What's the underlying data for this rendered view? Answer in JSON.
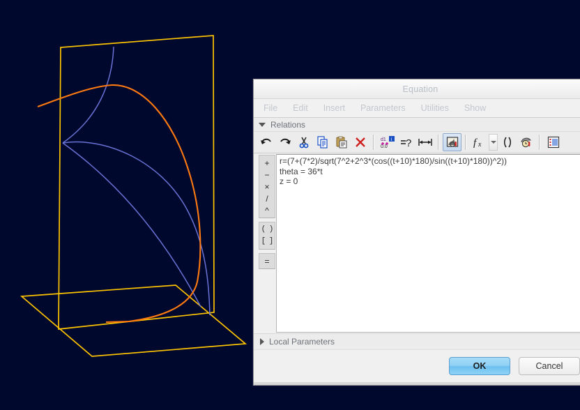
{
  "window": {
    "title": "Equation",
    "menu": [
      "File",
      "Edit",
      "Insert",
      "Parameters",
      "Utilities",
      "Show"
    ]
  },
  "relations": {
    "label": "Relations",
    "expanded": true,
    "toolbar": [
      {
        "name": "undo-icon",
        "tooltip": "Undo"
      },
      {
        "name": "redo-icon",
        "tooltip": "Redo"
      },
      {
        "name": "cut-icon",
        "tooltip": "Cut"
      },
      {
        "name": "copy-icon",
        "tooltip": "Copy"
      },
      {
        "name": "paste-icon",
        "tooltip": "Paste"
      },
      {
        "name": "delete-icon",
        "tooltip": "Delete"
      },
      {
        "name": "add-parameter-icon",
        "tooltip": "Add Parameter"
      },
      {
        "name": "verify-icon",
        "tooltip": "Verify"
      },
      {
        "name": "measure-icon",
        "tooltip": "Measure"
      },
      {
        "name": "image-tool-icon",
        "tooltip": "Insert Image"
      },
      {
        "name": "function-icon",
        "tooltip": "Functions"
      },
      {
        "name": "function-dropdown-icon",
        "tooltip": "Functions menu"
      },
      {
        "name": "parentheses-icon",
        "tooltip": "Parentheses"
      },
      {
        "name": "history-icon",
        "tooltip": "History"
      },
      {
        "name": "list-icon",
        "tooltip": "Relations List"
      }
    ],
    "operators": [
      [
        "+",
        "−",
        "×",
        "/",
        "^"
      ],
      [
        "( )",
        "[ ]"
      ],
      [
        "="
      ]
    ],
    "equation_lines": [
      "r=(7+(7*2)/sqrt(7^2+2^3*(cos((t+10)*180)/sin((t+10)*180))^2))",
      "theta = 36*t",
      "z = 0"
    ]
  },
  "local_parameters": {
    "label": "Local Parameters",
    "expanded": false
  },
  "buttons": {
    "ok": "OK",
    "cancel": "Cancel"
  },
  "colors": {
    "viewport_background": "#00082e",
    "plane_wireframe": "#ffc400",
    "curve_primary": "#ff7a10",
    "curve_secondary": "#6a72d6",
    "accent_button": "#8fd0f5"
  },
  "viewport": {
    "name": "3d-graphics-viewport",
    "description": "3D wireframe: vertical plane, horizontal plane, orange spiral curve and blue reference curves"
  }
}
